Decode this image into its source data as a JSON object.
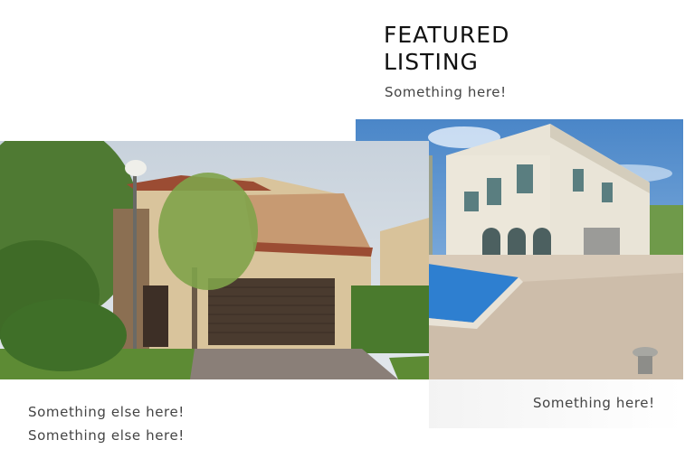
{
  "featured": {
    "heading": "FEATURED\nLISTING",
    "subtitle": "Something here!"
  },
  "listing_right": {
    "image_icon": "villa-pool-photo",
    "caption": "Something here!"
  },
  "listing_left": {
    "image_icon": "villa-garage-photo",
    "caption_line_1": "Something else here!",
    "caption_line_2": "Something else here!"
  }
}
